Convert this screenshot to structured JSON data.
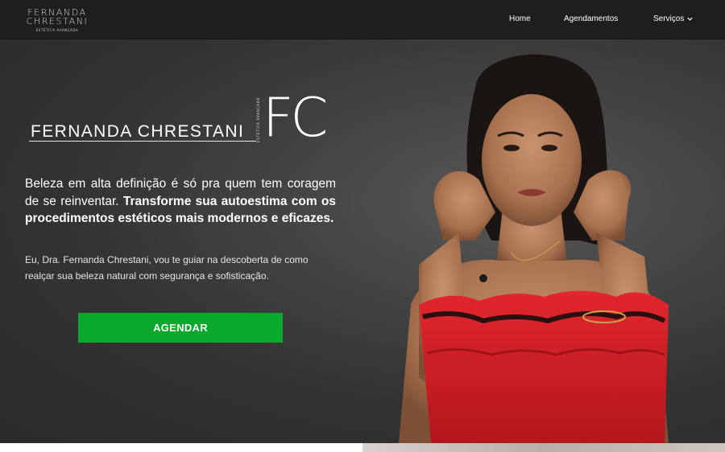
{
  "header": {
    "logo_line1": "FERNANDA",
    "logo_line2": "CHRESTANI",
    "logo_tagline": "ESTÉTICA AVANÇADA",
    "nav": {
      "home": "Home",
      "agendamentos": "Agendamentos",
      "servicos": "Serviços"
    }
  },
  "hero": {
    "brand_name": "FERNANDA CHRESTANI",
    "brand_tagline": "ESTÉTICA AVANÇADA",
    "brand_monogram": "FC",
    "headline_regular": "Beleza em alta definição é só pra quem tem coragem de se reinventar.",
    "headline_bold": "Transforme sua autoestima com os procedimentos estéticos mais modernos e eficazes.",
    "intro": "Eu, Dra. Fernanda Chrestani, vou te guiar na descoberta de como realçar sua beleza natural com segurança e sofisticação.",
    "cta_label": "AGENDAR"
  },
  "colors": {
    "header_bg": "#1e1e1e",
    "hero_bg": "#3a3a3a",
    "cta_green": "#0aa92b",
    "dress_red": "#d81f26"
  },
  "icons": {
    "nav_dropdown": "chevron-down-icon"
  }
}
